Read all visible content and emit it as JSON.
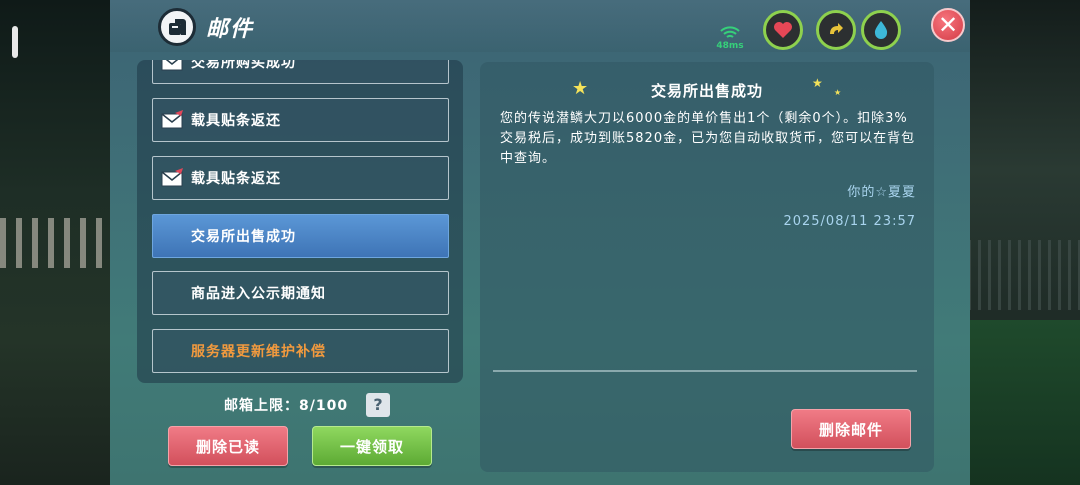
{
  "window": {
    "title": "邮件"
  },
  "status": {
    "ping": "48ms"
  },
  "stats": [
    {
      "icon": "heart-icon",
      "color": "#e64756"
    },
    {
      "icon": "stamina-icon",
      "color": "#e8c33a"
    },
    {
      "icon": "water-drop-icon",
      "color": "#3db8d8"
    }
  ],
  "mail_list": {
    "items": [
      {
        "label": "交易所购买成功",
        "icon": "envelope-icon"
      },
      {
        "label": "载具贴条返还",
        "icon": "envelope-icon"
      },
      {
        "label": "载具贴条返还",
        "icon": "envelope-icon"
      },
      {
        "label": "交易所出售成功",
        "selected": true
      },
      {
        "label": "商品进入公示期通知"
      },
      {
        "label": "服务器更新维护补偿",
        "color": "orange"
      }
    ],
    "limit_text": "邮箱上限：8/100",
    "help_label": "?"
  },
  "buttons": {
    "delete_read": "删除已读",
    "collect_all": "一键领取",
    "delete_mail": "删除邮件"
  },
  "detail": {
    "title": "交易所出售成功",
    "body": "您的传说潜鳞大刀以6000金的单价售出1个（剩余0个）。扣除3%交易税后，成功到账5820金，已为您自动收取货币，您可以在背包中查询。",
    "signature": "你的☆夏夏",
    "date": "2025/08/11 23:57"
  },
  "colors": {
    "accent_selected": "#4a86c8",
    "orange_text": "#f29a3e",
    "close_button": "#e14a55"
  }
}
